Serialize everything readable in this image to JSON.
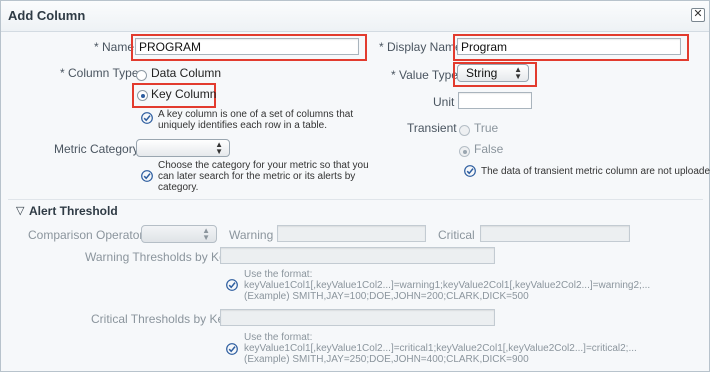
{
  "dialog": {
    "title": "Add Column",
    "close_glyph": "✕"
  },
  "left": {
    "name_label": "* Name",
    "name_value": "PROGRAM",
    "column_type_label": "* Column Type",
    "data_column_label": "Data Column",
    "key_column_label": "Key Column",
    "key_help_line1": "A key column is one of a set of columns that",
    "key_help_line2": "uniquely identifies each row in a table.",
    "metric_category_label": "Metric Category",
    "metric_category_value": "",
    "metric_help_line1": "Choose the category for your metric so that you",
    "metric_help_line2": "can later search for the metric or its alerts by",
    "metric_help_line3": "category."
  },
  "right": {
    "display_name_label": "* Display Name",
    "display_name_value": "Program",
    "value_type_label": "* Value Type",
    "value_type_value": "String",
    "unit_label": "Unit",
    "unit_value": "",
    "transient_label": "Transient",
    "true_label": "True",
    "false_label": "False",
    "transient_help": "The data of transient metric column are not uploaded."
  },
  "alert": {
    "section_title": "Alert Threshold",
    "toggle_glyph": "▽",
    "comparison_operator_label": "Comparison Operator",
    "warning_label": "Warning",
    "critical_label": "Critical",
    "warning_by_key_label": "Warning Thresholds by Key",
    "warning_help_line1": "Use the format:",
    "warning_help_line2": "keyValue1Col1[,keyValue1Col2...]=warning1;keyValue2Col1[,keyValue2Col2...]=warning2;...",
    "warning_help_line3": "(Example) SMITH,JAY=100;DOE,JOHN=200;CLARK,DICK=500",
    "critical_by_key_label": "Critical Thresholds by Key",
    "critical_help_line1": "Use the format:",
    "critical_help_line2": "keyValue1Col1[,keyValue1Col2...]=critical1;keyValue2Col1[,keyValue2Col2...]=critical2;...",
    "critical_help_line3": "(Example) SMITH,JAY=250;DOE,JOHN=400;CLARK,DICK=900"
  },
  "colors": {
    "highlight": "#e23b2e",
    "check": "#2d5d9f",
    "radio_selected": "#2d5d9f"
  }
}
